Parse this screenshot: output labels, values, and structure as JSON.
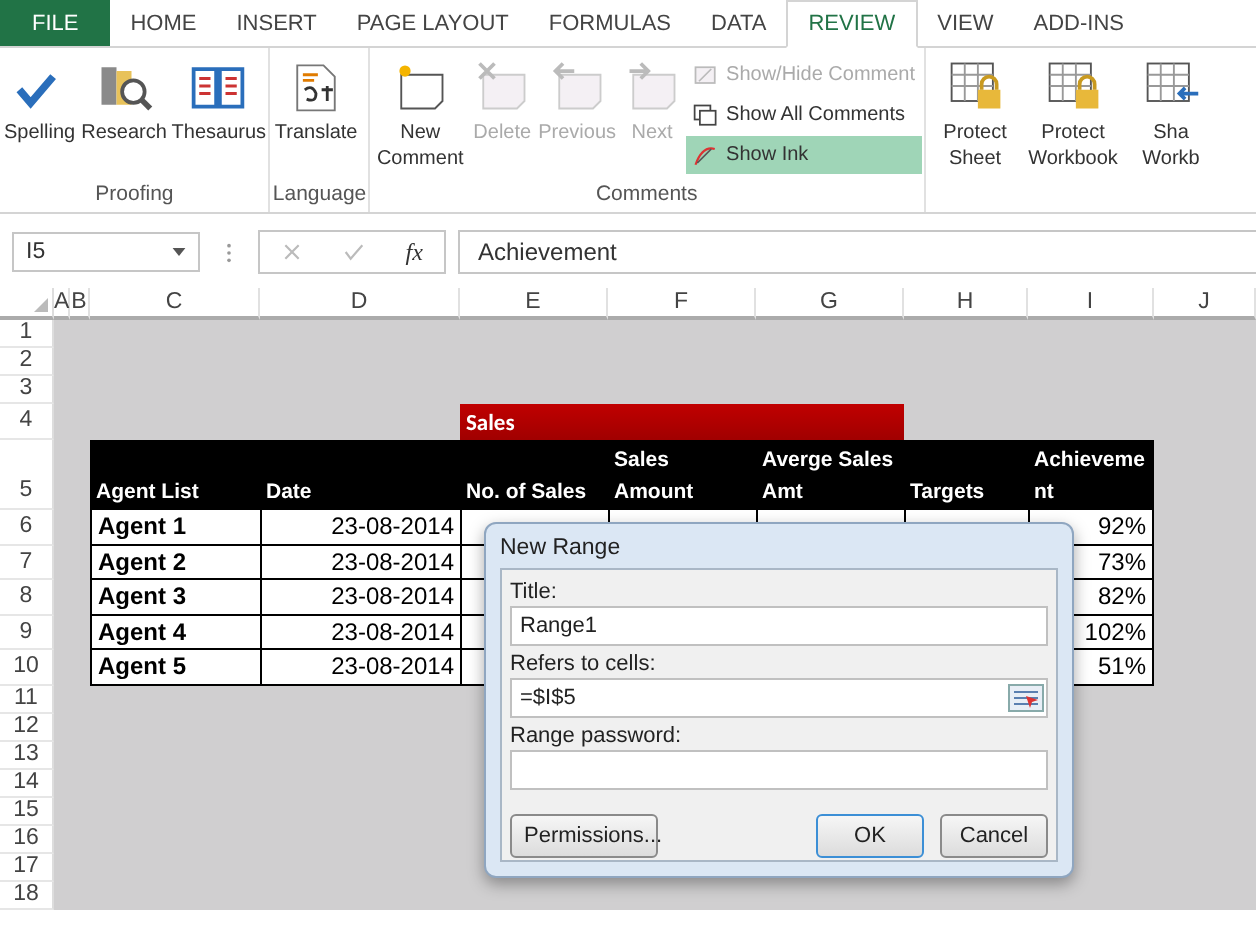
{
  "ribbon": {
    "tabs": [
      {
        "label": "FILE",
        "kind": "file",
        "selected": false
      },
      {
        "label": "HOME",
        "kind": "tab",
        "selected": false
      },
      {
        "label": "INSERT",
        "kind": "tab",
        "selected": false
      },
      {
        "label": "PAGE LAYOUT",
        "kind": "tab",
        "selected": false
      },
      {
        "label": "FORMULAS",
        "kind": "tab",
        "selected": false
      },
      {
        "label": "DATA",
        "kind": "tab",
        "selected": false
      },
      {
        "label": "REVIEW",
        "kind": "tab",
        "selected": true
      },
      {
        "label": "VIEW",
        "kind": "tab",
        "selected": false
      },
      {
        "label": "ADD-INS",
        "kind": "tab",
        "selected": false
      }
    ],
    "groups": [
      {
        "label": "Proofing",
        "items": [
          {
            "label": "Spelling",
            "kind": "large",
            "disabled": false
          },
          {
            "label": "Research",
            "kind": "large",
            "disabled": false
          },
          {
            "label": "Thesaurus",
            "kind": "large",
            "disabled": false
          }
        ]
      },
      {
        "label": "Language",
        "items": [
          {
            "label": "Translate",
            "kind": "large",
            "disabled": false
          }
        ]
      },
      {
        "label": "Comments",
        "items": [
          {
            "label": "New Comment",
            "kind": "large",
            "disabled": false
          },
          {
            "label": "Delete",
            "kind": "large",
            "disabled": true
          },
          {
            "label": "Previous",
            "kind": "large",
            "disabled": true
          },
          {
            "label": "Next",
            "kind": "large",
            "disabled": true
          },
          {
            "label": "Show/Hide Comment",
            "kind": "small",
            "disabled": true,
            "selected": false
          },
          {
            "label": "Show All Comments",
            "kind": "small",
            "disabled": false,
            "selected": false
          },
          {
            "label": "Show Ink",
            "kind": "small",
            "disabled": false,
            "selected": true
          }
        ]
      },
      {
        "items": [
          {
            "label": "Protect Sheet",
            "kind": "large",
            "disabled": false
          },
          {
            "label": "Protect Workbook",
            "kind": "large",
            "disabled": false
          },
          {
            "label": "Sha Workb",
            "kind": "large",
            "disabled": false
          }
        ]
      }
    ]
  },
  "formula_bar": {
    "name_box": "I5",
    "function_label": "fx",
    "formula": "Achievement"
  },
  "sheet": {
    "columns": [
      "A",
      "B",
      "C",
      "D",
      "E",
      "F",
      "G",
      "H",
      "I",
      "J"
    ],
    "rows": [
      {
        "number": "1",
        "kind": "blank"
      },
      {
        "number": "2",
        "kind": "blank"
      },
      {
        "number": "3",
        "kind": "blank"
      },
      {
        "number": "4",
        "kind": "title",
        "title": "Sales"
      },
      {
        "number": "5",
        "kind": "header",
        "cells": [
          "Agent List",
          "Date",
          "No. of Sales",
          "Sales Amount",
          "Averge Sales Amt",
          "Targets",
          "Achievement"
        ]
      },
      {
        "number": "6",
        "kind": "data",
        "cells": [
          "Agent 1",
          "23-08-2014",
          null,
          null,
          null,
          null,
          "92%"
        ]
      },
      {
        "number": "7",
        "kind": "data",
        "cells": [
          "Agent 2",
          "23-08-2014",
          null,
          null,
          null,
          null,
          "73%"
        ]
      },
      {
        "number": "8",
        "kind": "data",
        "cells": [
          "Agent 3",
          "23-08-2014",
          null,
          null,
          null,
          null,
          "82%"
        ]
      },
      {
        "number": "9",
        "kind": "data",
        "cells": [
          "Agent 4",
          "23-08-2014",
          null,
          null,
          null,
          null,
          "102%"
        ]
      },
      {
        "number": "10",
        "kind": "data",
        "cells": [
          "Agent 5",
          "23-08-2014",
          null,
          null,
          null,
          null,
          "51%"
        ]
      },
      {
        "number": "11",
        "kind": "blank"
      },
      {
        "number": "12",
        "kind": "blank"
      },
      {
        "number": "13",
        "kind": "blank"
      },
      {
        "number": "14",
        "kind": "blank"
      },
      {
        "number": "15",
        "kind": "blank"
      },
      {
        "number": "16",
        "kind": "blank"
      },
      {
        "number": "17",
        "kind": "blank"
      },
      {
        "number": "18",
        "kind": "blank"
      }
    ]
  },
  "dialog": {
    "title": "New Range",
    "fields": [
      {
        "label": "Title:",
        "value": "Range1",
        "kind": "text"
      },
      {
        "label": "Refers to cells:",
        "value": "=$I$5",
        "kind": "ref"
      },
      {
        "label": "Range password:",
        "kind": "text"
      }
    ],
    "buttons": [
      {
        "label": "Permissions...",
        "kind": "left",
        "default": false
      },
      {
        "label": "OK",
        "kind": "right",
        "default": true
      },
      {
        "label": "Cancel",
        "kind": "right",
        "default": false
      }
    ]
  }
}
